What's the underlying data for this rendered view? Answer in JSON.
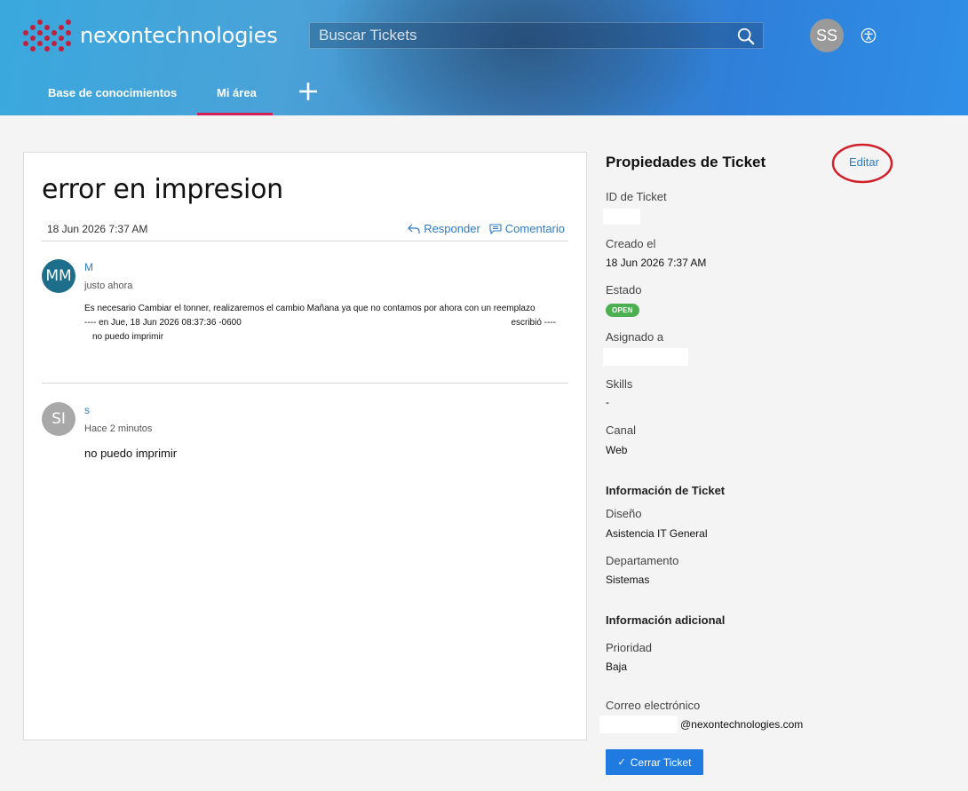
{
  "header": {
    "brand": "nexontechnologies",
    "search_placeholder": "Buscar Tickets",
    "user_initials": "SS",
    "nav": {
      "knowledge_base": "Base de conocimientos",
      "my_area": "Mi área",
      "add": "+"
    }
  },
  "ticket": {
    "title": "error en impresion",
    "date": "18 Jun 2026 7:37 AM",
    "reply_label": "Responder",
    "comment_label": "Comentario",
    "posts": [
      {
        "initials": "MM",
        "avatar_color": "#1d6e8a",
        "author": "M",
        "time": "justo ahora",
        "line1": "Es necesario Cambiar el tonner, realizaremos el cambio Mañana ya que no contamos por ahora con un reemplazo",
        "line2_left": "---- en Jue, 18 Jun 2026 08:37:36 -0600",
        "line2_right": "escribió ----",
        "line3": "no puedo imprimir"
      },
      {
        "initials": "SI",
        "avatar_color": "#a8a8a8",
        "author": "s",
        "time": "Hace 2 minutos",
        "text": "no puedo imprimir"
      }
    ]
  },
  "properties": {
    "title": "Propiedades de Ticket",
    "edit_label": "Editar",
    "ticket_id_label": "ID de Ticket",
    "created_label": "Creado el",
    "created_value": "18 Jun 2026 7:37 AM",
    "status_label": "Estado",
    "status_value": "OPEN",
    "status_color": "#4caf50",
    "assigned_label": "Asignado a",
    "skills_label": "Skills",
    "skills_value": "-",
    "channel_label": "Canal",
    "channel_value": "Web",
    "ticket_info_heading": "Información de Ticket",
    "design_label": "Diseño",
    "design_value": "Asistencia IT General",
    "department_label": "Departamento",
    "department_value": "Sistemas",
    "additional_heading": "Información adicional",
    "priority_label": "Prioridad",
    "priority_value": "Baja",
    "email_label": "Correo electrónico",
    "email_value": "@nexontechnologies.com",
    "close_button": "Cerrar Ticket"
  },
  "colors": {
    "accent": "#2e7bc4",
    "nav_active": "#d2215a",
    "button": "#1f7be0",
    "annotation": "#d0202a"
  }
}
